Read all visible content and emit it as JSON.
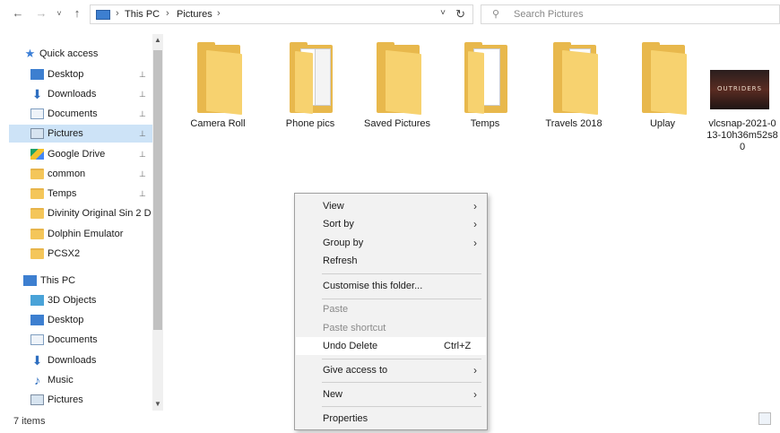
{
  "address_bar": {
    "back": "←",
    "forward": "→",
    "recent": "˅",
    "up": "↑",
    "breadcrumb": [
      "This PC",
      "Pictures"
    ],
    "separator": "›",
    "dropdown": "˅",
    "refresh": "↻"
  },
  "search": {
    "placeholder": "Search Pictures",
    "icon": "search-icon"
  },
  "navigation": {
    "quick_access": {
      "label": "Quick access",
      "items": [
        {
          "label": "Desktop",
          "icon": "desktop-icon",
          "pinned": true
        },
        {
          "label": "Downloads",
          "icon": "download-icon",
          "pinned": true
        },
        {
          "label": "Documents",
          "icon": "documents-icon",
          "pinned": true
        },
        {
          "label": "Pictures",
          "icon": "pictures-icon",
          "pinned": true,
          "selected": true
        },
        {
          "label": "Google Drive",
          "icon": "google-drive-icon",
          "pinned": true
        },
        {
          "label": "common",
          "icon": "folder-icon",
          "pinned": true
        },
        {
          "label": "Temps",
          "icon": "folder-icon",
          "pinned": true
        },
        {
          "label": "Divinity Original Sin 2 D",
          "icon": "folder-icon",
          "pinned": false
        },
        {
          "label": "Dolphin Emulator",
          "icon": "folder-icon",
          "pinned": false
        },
        {
          "label": "PCSX2",
          "icon": "folder-icon",
          "pinned": false
        }
      ]
    },
    "this_pc": {
      "label": "This PC",
      "items": [
        {
          "label": "3D Objects",
          "icon": "3d-objects-icon"
        },
        {
          "label": "Desktop",
          "icon": "desktop-icon"
        },
        {
          "label": "Documents",
          "icon": "documents-icon"
        },
        {
          "label": "Downloads",
          "icon": "download-icon"
        },
        {
          "label": "Music",
          "icon": "music-icon"
        },
        {
          "label": "Pictures",
          "icon": "pictures-icon"
        }
      ]
    },
    "pin_glyph": "📌"
  },
  "files": [
    {
      "name": "Camera Roll",
      "type": "folder"
    },
    {
      "name": "Phone pics",
      "type": "folder-with-photo"
    },
    {
      "name": "Saved Pictures",
      "type": "folder"
    },
    {
      "name": "Temps",
      "type": "folder-with-photo"
    },
    {
      "name": "Travels 2018",
      "type": "folder-with-docs"
    },
    {
      "name": "Uplay",
      "type": "folder"
    },
    {
      "name": "vlcsnap-2021-0 13-10h36m52s8 0",
      "type": "image",
      "thumb_text": "OUTRIDERS"
    }
  ],
  "status_bar": {
    "item_count": "7 items"
  },
  "context_menu": {
    "items": [
      {
        "label": "View",
        "submenu": true,
        "disabled": false
      },
      {
        "label": "Sort by",
        "submenu": true,
        "disabled": false
      },
      {
        "label": "Group by",
        "submenu": true,
        "disabled": false
      },
      {
        "label": "Refresh",
        "submenu": false,
        "disabled": false
      },
      {
        "label": "Customise this folder...",
        "submenu": false,
        "disabled": false
      },
      {
        "label": "Paste",
        "submenu": false,
        "disabled": true
      },
      {
        "label": "Paste shortcut",
        "submenu": false,
        "disabled": true
      },
      {
        "label": "Undo Delete",
        "submenu": false,
        "disabled": false,
        "shortcut": "Ctrl+Z",
        "hover": true
      },
      {
        "label": "Give access to",
        "submenu": true,
        "disabled": false
      },
      {
        "label": "New",
        "submenu": true,
        "disabled": false
      },
      {
        "label": "Properties",
        "submenu": false,
        "disabled": false
      }
    ],
    "arrow": "›"
  },
  "colors": {
    "selection": "#cde3f7",
    "folder": "#f4c65a",
    "accent": "#3d7fd0",
    "menu_bg": "#f2f2f2"
  }
}
